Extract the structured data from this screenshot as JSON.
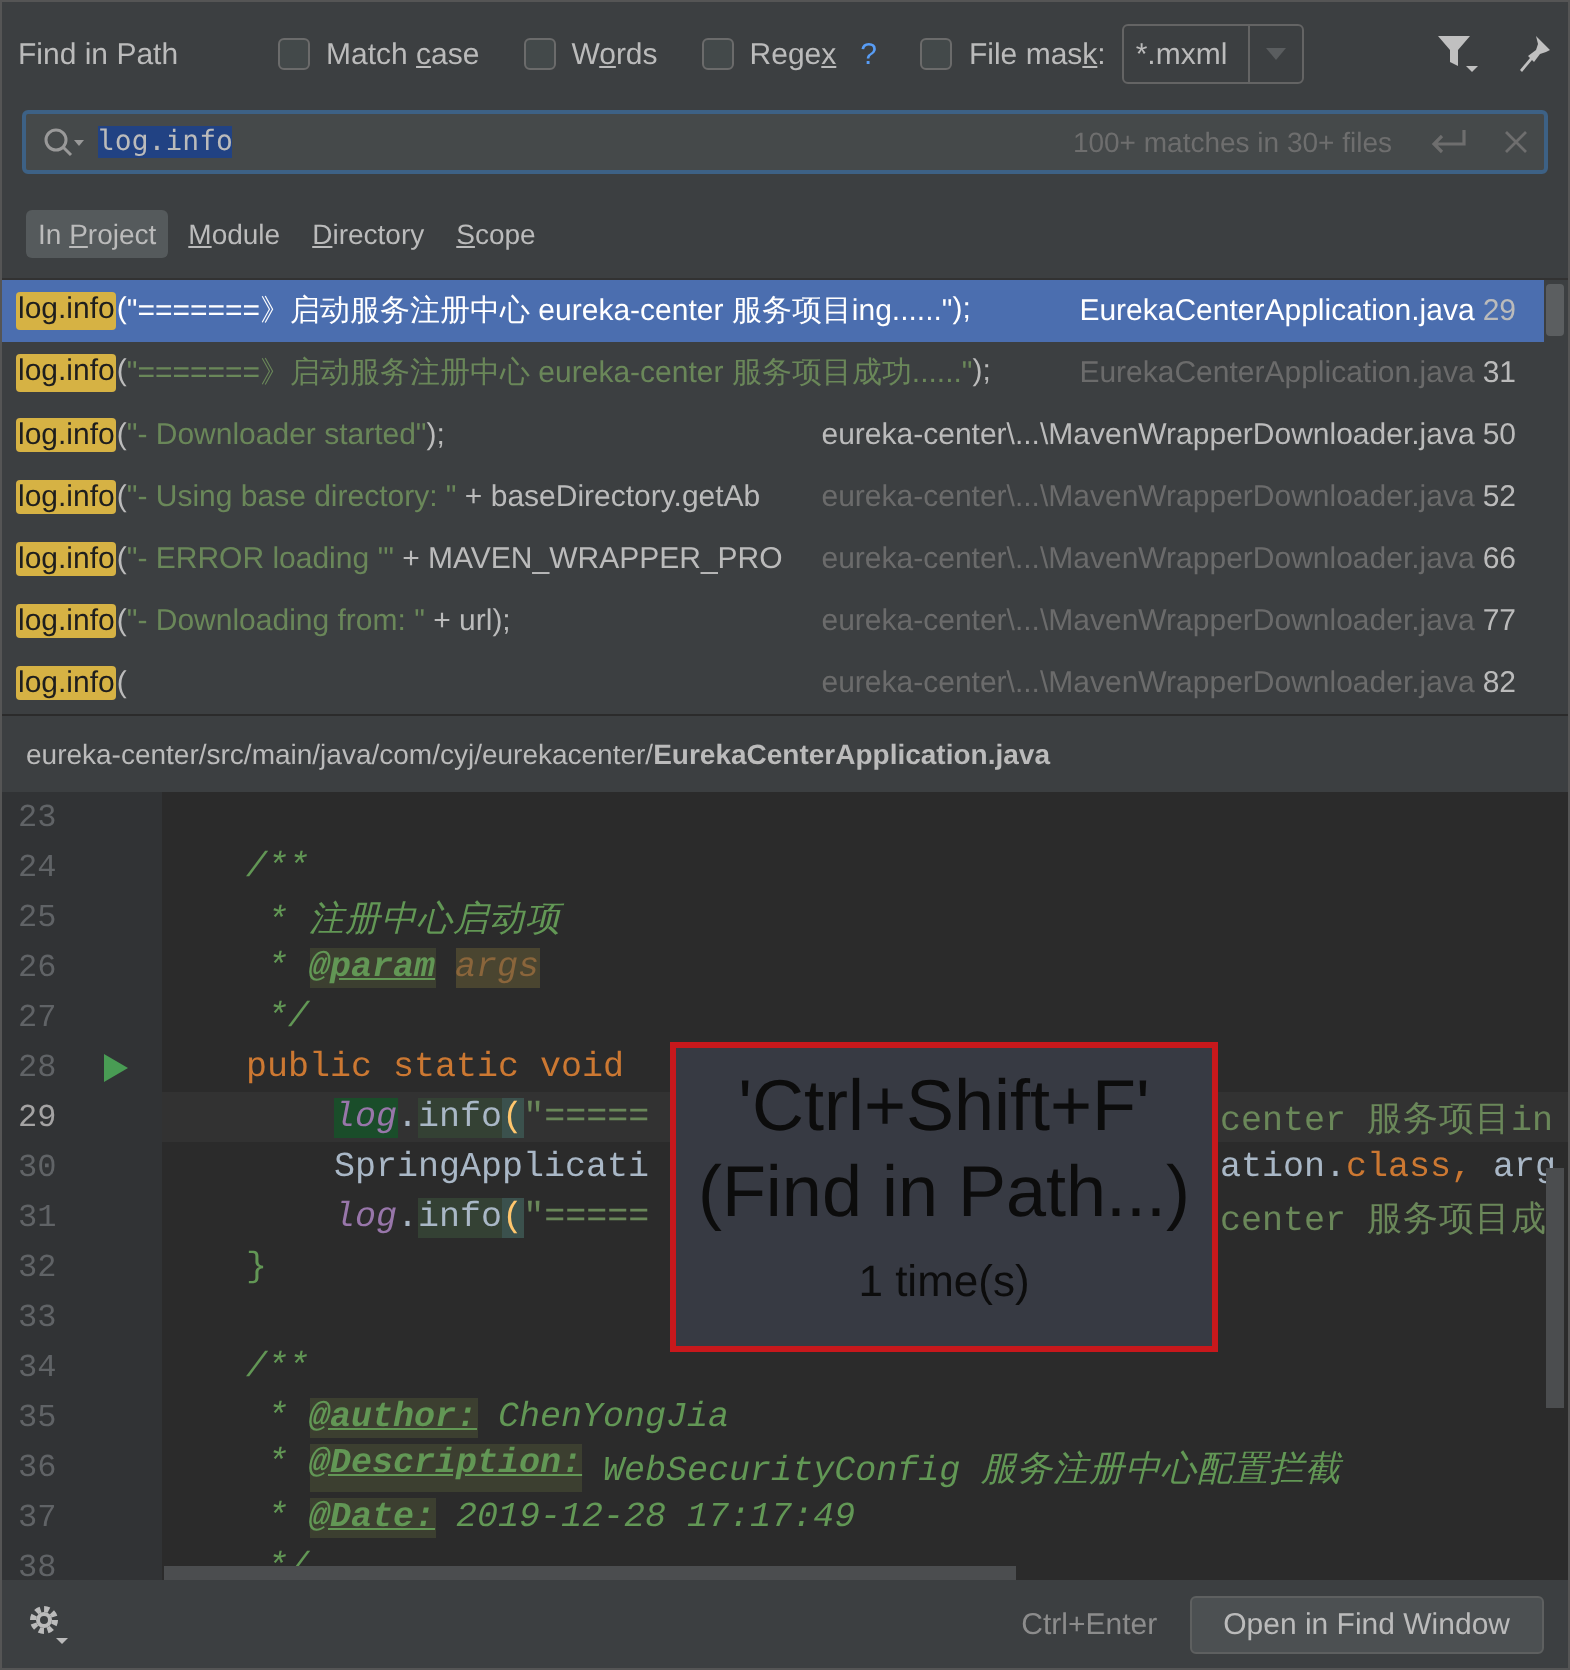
{
  "header": {
    "title": "Find in Path",
    "options": [
      {
        "before": "Match ",
        "key": "c",
        "after": "ase",
        "checked": false
      },
      {
        "before": "W",
        "key": "o",
        "after": "rds",
        "checked": false
      },
      {
        "before": "Rege",
        "key": "x",
        "checked": false,
        "help": "?"
      },
      {
        "before": "File mas",
        "key": "k",
        "after": ":",
        "checked": false
      }
    ],
    "file_mask": {
      "value": "*.mxml",
      "disabled": true
    }
  },
  "search": {
    "value": "log.info",
    "selected": true,
    "status": "100+ matches in 30+ files"
  },
  "scopes": [
    {
      "before": "In ",
      "key": "P",
      "after": "roject",
      "selected": true
    },
    {
      "key": "M",
      "after": "odule",
      "selected": false
    },
    {
      "key": "D",
      "after": "irectory",
      "selected": false
    },
    {
      "key": "S",
      "after": "cope",
      "selected": false
    }
  ],
  "results": [
    {
      "match": "log.info",
      "tokens": [
        {
          "kind": "punct",
          "text": "("
        },
        {
          "kind": "string",
          "text": "\"=======》启动服务注册中心 eureka-center 服务项目ing......\""
        },
        {
          "kind": "punct",
          "text": ");"
        }
      ],
      "file": "EurekaCenterApplication.java",
      "line": "29",
      "selected": true,
      "dimmed": false
    },
    {
      "match": "log.info",
      "tokens": [
        {
          "kind": "punct",
          "text": "("
        },
        {
          "kind": "string",
          "text": "\"=======》启动服务注册中心 eureka-center 服务项目成功......\""
        },
        {
          "kind": "punct",
          "text": ");"
        }
      ],
      "file": "EurekaCenterApplication.java",
      "line": "31",
      "selected": false,
      "dimmed": true
    },
    {
      "match": "log.info",
      "tokens": [
        {
          "kind": "punct",
          "text": "("
        },
        {
          "kind": "string",
          "text": "\"- Downloader started\""
        },
        {
          "kind": "punct",
          "text": ");"
        }
      ],
      "file": "eureka-center\\...\\MavenWrapperDownloader.java",
      "line": "50",
      "selected": false,
      "dimmed": false
    },
    {
      "match": "log.info",
      "tokens": [
        {
          "kind": "punct",
          "text": "("
        },
        {
          "kind": "string",
          "text": "\"- Using base directory: \""
        },
        {
          "kind": "code",
          "text": " + baseDirectory.getAb"
        }
      ],
      "file": "eureka-center\\...\\MavenWrapperDownloader.java",
      "line": "52",
      "selected": false,
      "dimmed": true
    },
    {
      "match": "log.info",
      "tokens": [
        {
          "kind": "punct",
          "text": "("
        },
        {
          "kind": "string",
          "text": "\"- ERROR loading '\""
        },
        {
          "kind": "code",
          "text": " + MAVEN_WRAPPER_PRO"
        }
      ],
      "file": "eureka-center\\...\\MavenWrapperDownloader.java",
      "line": "66",
      "selected": false,
      "dimmed": true
    },
    {
      "match": "log.info",
      "tokens": [
        {
          "kind": "punct",
          "text": "("
        },
        {
          "kind": "string",
          "text": "\"- Downloading from: \""
        },
        {
          "kind": "code",
          "text": " + url"
        },
        {
          "kind": "punct",
          "text": ");"
        }
      ],
      "file": "eureka-center\\...\\MavenWrapperDownloader.java",
      "line": "77",
      "selected": false,
      "dimmed": true
    },
    {
      "match": "log.info",
      "tokens": [
        {
          "kind": "punct",
          "text": "("
        }
      ],
      "file": "eureka-center\\...\\MavenWrapperDownloader.java",
      "line": "82",
      "selected": false,
      "dimmed": true
    }
  ],
  "path": "eureka-center/src/main/java/com/cyj/eurekacenter/**EurekaCenterApplication.java**",
  "editor": {
    "lines": [
      {
        "number": "23",
        "current": false
      },
      {
        "number": "24",
        "current": false,
        "tokens": [
          {
            "kind": "comment",
            "text": "    /**"
          }
        ]
      },
      {
        "number": "25",
        "current": false,
        "tokens": [
          {
            "kind": "comment",
            "text": "     * 注册中心启动项"
          }
        ]
      },
      {
        "number": "26",
        "current": false,
        "tokens": [
          {
            "kind": "comment",
            "text": "     * "
          },
          {
            "kind": "tag",
            "text": "@param"
          },
          {
            "kind": "param",
            "text": "args"
          }
        ]
      },
      {
        "number": "27",
        "current": false,
        "tokens": [
          {
            "kind": "comment",
            "text": "     */"
          }
        ]
      },
      {
        "number": "28",
        "current": false,
        "run": true,
        "tokens": [
          {
            "kind": "keyword",
            "text": "    public static void"
          }
        ]
      },
      {
        "number": "29",
        "current": true,
        "tokens": [
          {
            "kind": "field-current",
            "text": "log"
          },
          {
            "kind": "plain",
            "text": "."
          },
          {
            "kind": "method-hit",
            "text": "info"
          },
          {
            "kind": "brace",
            "text": "("
          },
          {
            "kind": "string",
            "text": "\"====="
          }
        ],
        "right": [
          {
            "kind": "string",
            "text": "center 服务项目in"
          }
        ]
      },
      {
        "number": "30",
        "current": false,
        "tokens": [
          {
            "kind": "plain",
            "text": "SpringApplicati"
          }
        ],
        "right": [
          {
            "kind": "plain",
            "text": "ation."
          },
          {
            "kind": "keyword",
            "text": "class, "
          },
          {
            "kind": "plain",
            "text": "arg"
          }
        ]
      },
      {
        "number": "31",
        "current": false,
        "tokens": [
          {
            "kind": "field",
            "text": "log"
          },
          {
            "kind": "plain",
            "text": "."
          },
          {
            "kind": "method-hit",
            "text": "info"
          },
          {
            "kind": "brace",
            "text": "("
          },
          {
            "kind": "string",
            "text": "\"====="
          }
        ],
        "right": [
          {
            "kind": "string",
            "text": "center 服务项目成"
          }
        ]
      },
      {
        "number": "32",
        "current": false,
        "tokens": [
          {
            "kind": "brace2",
            "text": "    }"
          }
        ]
      },
      {
        "number": "33",
        "current": false
      },
      {
        "number": "34",
        "current": false,
        "tokens": [
          {
            "kind": "comment",
            "text": "    /**"
          }
        ]
      },
      {
        "number": "35",
        "current": false,
        "tokens": [
          {
            "kind": "comment",
            "text": "     * "
          },
          {
            "kind": "tag",
            "text": "@author:"
          },
          {
            "kind": "comment",
            "text": " ChenYongJia"
          }
        ]
      },
      {
        "number": "36",
        "current": false,
        "tokens": [
          {
            "kind": "comment",
            "text": "     * "
          },
          {
            "kind": "tag",
            "text": "@Description:"
          },
          {
            "kind": "comment",
            "text": " WebSecurityConfig 服务注册中心配置拦截"
          }
        ]
      },
      {
        "number": "37",
        "current": false,
        "tokens": [
          {
            "kind": "comment",
            "text": "     * "
          },
          {
            "kind": "tag",
            "text": "@Date:"
          },
          {
            "kind": "comment",
            "text": " 2019-12-28 17:17:49"
          }
        ]
      },
      {
        "number": "38",
        "current": false,
        "tokens": [
          {
            "kind": "comment",
            "text": "     */"
          }
        ]
      }
    ]
  },
  "shortcut_popup": {
    "keys": "'Ctrl+Shift+F'",
    "action": "(Find in Path...)",
    "count": "1 time(s)"
  },
  "footer": {
    "hint": "Ctrl+Enter",
    "button": "Open in Find Window"
  }
}
